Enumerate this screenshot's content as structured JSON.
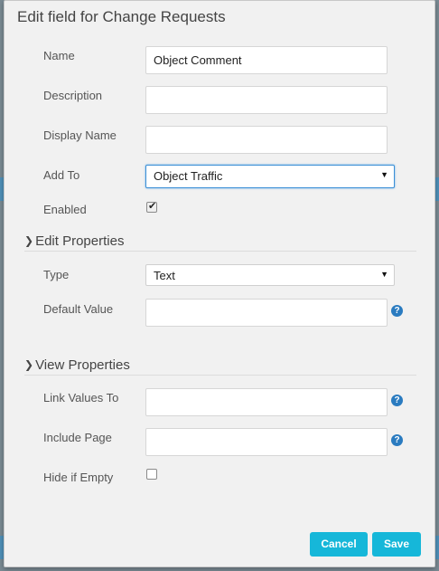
{
  "modal": {
    "title": "Edit field for Change Requests"
  },
  "fields": {
    "name": {
      "label": "Name",
      "value": "Object Comment"
    },
    "description": {
      "label": "Description",
      "value": ""
    },
    "display_name": {
      "label": "Display Name",
      "value": ""
    },
    "add_to": {
      "label": "Add To",
      "value": "Object Traffic"
    },
    "enabled": {
      "label": "Enabled",
      "checked": true
    }
  },
  "edit_properties": {
    "title": "Edit Properties",
    "type": {
      "label": "Type",
      "value": "Text"
    },
    "default_value": {
      "label": "Default Value",
      "value": ""
    }
  },
  "view_properties": {
    "title": "View Properties",
    "link_values_to": {
      "label": "Link Values To",
      "value": ""
    },
    "include_page": {
      "label": "Include Page",
      "value": ""
    },
    "hide_if_empty": {
      "label": "Hide if Empty",
      "checked": false
    }
  },
  "buttons": {
    "cancel": "Cancel",
    "save": "Save"
  },
  "icons": {
    "help": "question-circle-icon",
    "section_toggle": "chevron-down-icon",
    "dropdown": "caret-down-icon"
  },
  "colors": {
    "accent_button": "#16b7d9",
    "help_icon": "#2a7bc0",
    "focus_border": "#3b8fd6"
  }
}
